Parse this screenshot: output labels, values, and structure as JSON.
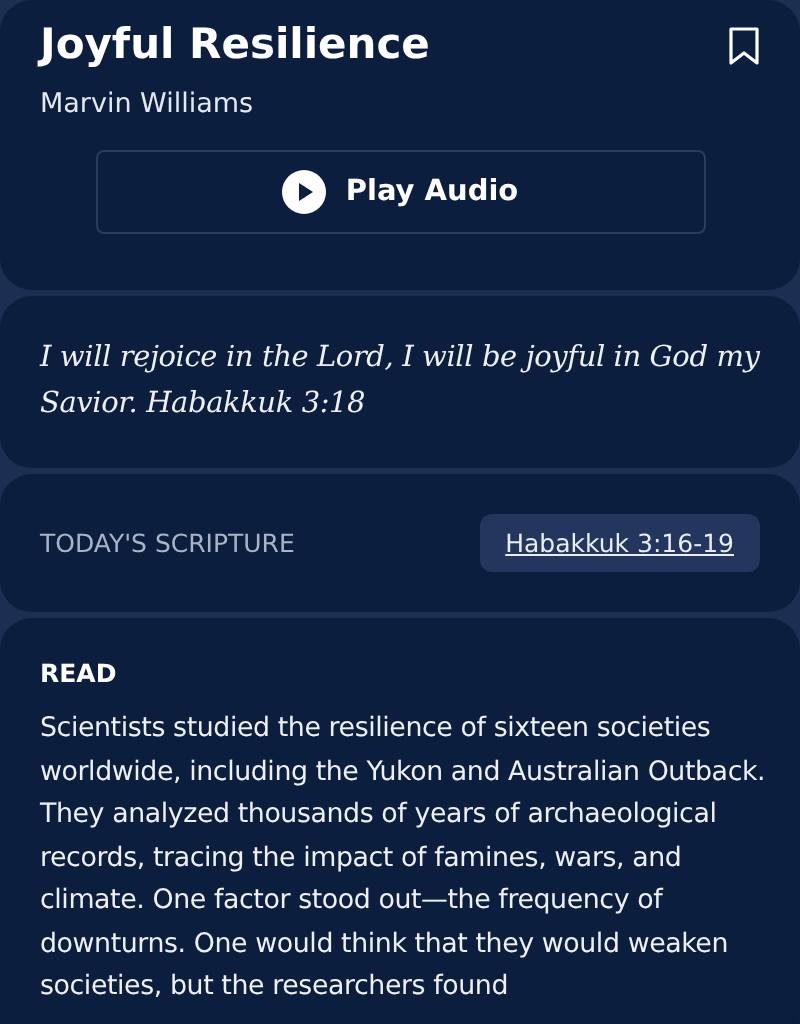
{
  "header": {
    "title": "Joyful Resilience",
    "author": "Marvin Williams",
    "bookmarked": false,
    "play_button": "Play Audio"
  },
  "verse": "I will rejoice in the Lord, I will be joyful in God my Savior. Habakkuk 3:18",
  "scripture": {
    "label": "TODAY'S SCRIPTURE",
    "link": "Habakkuk 3:16-19"
  },
  "read": {
    "heading": "READ",
    "body": "Scientists studied the resilience of sixteen societies worldwide, including the Yukon and Australian Outback. They analyzed thousands of years of archaeological records, tracing the impact of famines, wars, and climate. One factor stood out—the frequency of downturns. One would think that they would weaken societies, but the researchers found"
  }
}
